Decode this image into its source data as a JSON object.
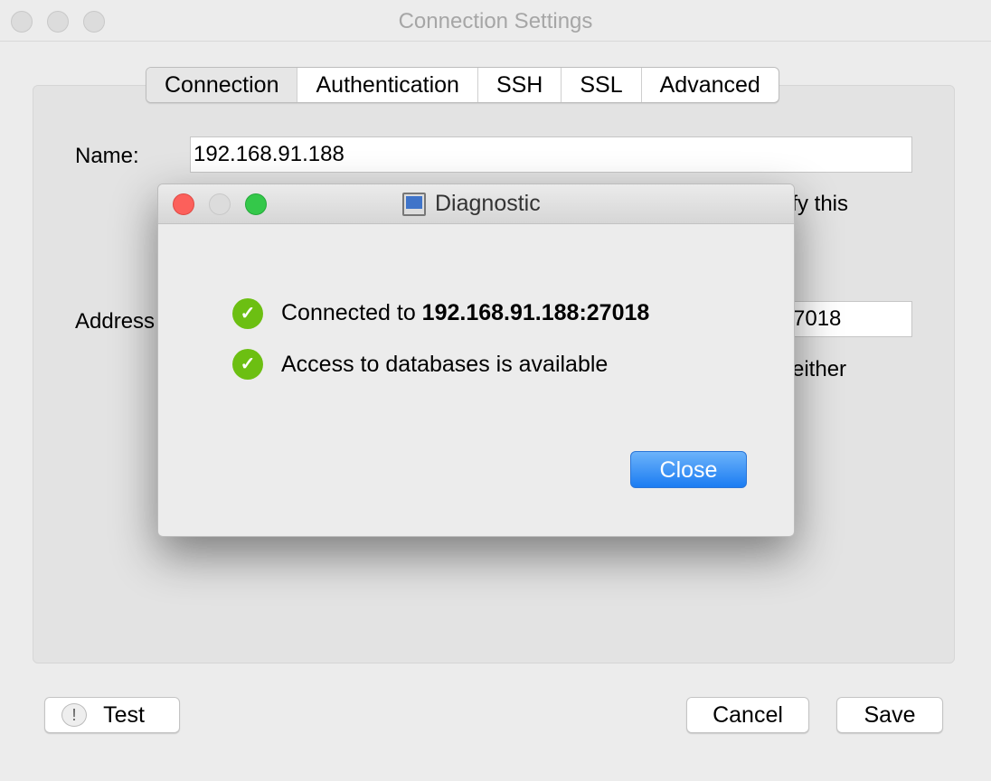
{
  "window": {
    "title": "Connection Settings"
  },
  "tabs": [
    {
      "label": "Connection",
      "active": true
    },
    {
      "label": "Authentication"
    },
    {
      "label": "SSH"
    },
    {
      "label": "SSL"
    },
    {
      "label": "Advanced"
    }
  ],
  "form": {
    "name_label": "Name:",
    "name_value": "192.168.91.188",
    "hint_fragment": "ify this",
    "address_label": "Address",
    "port_fragment": "7018",
    "hint2_fragment": "either"
  },
  "buttons": {
    "test": "Test",
    "cancel": "Cancel",
    "save": "Save"
  },
  "dialog": {
    "title": "Diagnostic",
    "messages": [
      {
        "prefix": "Connected to ",
        "bold": "192.168.91.188:27018",
        "status": "success"
      },
      {
        "prefix": "Access to databases is available",
        "bold": "",
        "status": "success"
      }
    ],
    "close": "Close"
  },
  "colors": {
    "success": "#6cbf12",
    "accent": "#1b7cf2"
  }
}
